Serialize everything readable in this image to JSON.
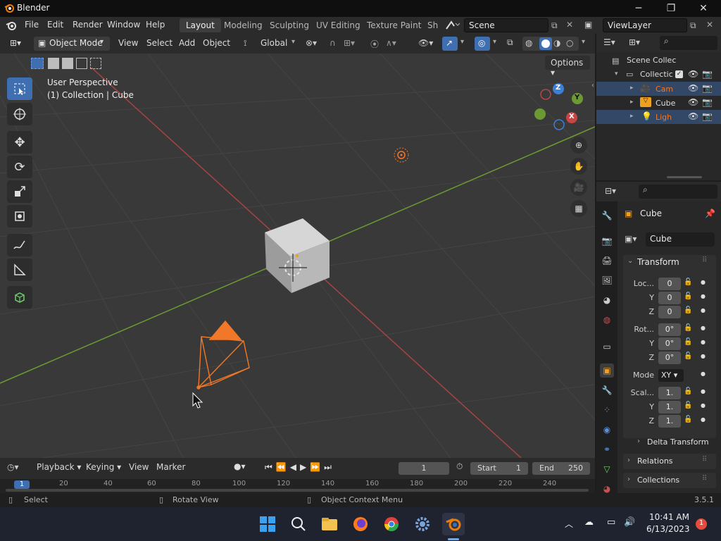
{
  "titlebar": {
    "title": "Blender",
    "minimize": "─",
    "maximize": "❐",
    "close": "✕"
  },
  "menu": {
    "file": "File",
    "edit": "Edit",
    "render": "Render",
    "window": "Window",
    "help": "Help"
  },
  "workspaces": [
    "Layout",
    "Modeling",
    "Sculpting",
    "UV Editing",
    "Texture Paint",
    "Sh"
  ],
  "scene": {
    "name": "Scene"
  },
  "view_layer": {
    "name": "ViewLayer"
  },
  "viewport_header": {
    "mode": "Object Mode",
    "view": "View",
    "select": "Select",
    "add": "Add",
    "object": "Object",
    "transform_orientation": "Global",
    "options": "Options"
  },
  "viewport": {
    "perspective_label": "User Perspective",
    "collection_label": "(1) Collection | Cube",
    "gizmo": {
      "x": "X",
      "y": "Y",
      "z": "Z"
    }
  },
  "outliner": {
    "items": [
      {
        "label": "Scene Collec"
      },
      {
        "label": "Collectic"
      },
      {
        "label": "Cam"
      },
      {
        "label": "Cube"
      },
      {
        "label": "Ligh"
      }
    ]
  },
  "properties": {
    "object_name": "Cube",
    "data_name": "Cube",
    "transform_header": "Transform",
    "location_label": "Loc...",
    "loc": [
      "0",
      "0",
      "0"
    ],
    "rotation_label": "Rot...",
    "rot": [
      "0°",
      "0°",
      "0°"
    ],
    "axis_y": "Y",
    "axis_z": "Z",
    "mode_label": "Mode",
    "mode_value": "XY",
    "scale_label": "Scal...",
    "scale": [
      "1.",
      "1.",
      "1."
    ],
    "delta_transform": "Delta Transform",
    "relations": "Relations",
    "collections": "Collections"
  },
  "timeline": {
    "playback": "Playback",
    "keying": "Keying",
    "view": "View",
    "marker": "Marker",
    "current_frame": "1",
    "start_label": "Start",
    "start": "1",
    "end_label": "End",
    "end": "250",
    "ruler": [
      "1",
      "20",
      "40",
      "60",
      "80",
      "100",
      "120",
      "140",
      "160",
      "180",
      "200",
      "220",
      "240"
    ]
  },
  "statusbar": {
    "select": "Select",
    "rotate": "Rotate View",
    "context": "Object Context Menu",
    "version": "3.5.1"
  },
  "taskbar": {
    "time": "10:41 AM",
    "date": "6/13/2023",
    "notifications": "1"
  },
  "colors": {
    "accent": "#3f6fb0",
    "selected_orange": "#f07828",
    "x_axis": "#c84545",
    "y_axis": "#7ab33a",
    "z_axis": "#3b7fd6"
  }
}
